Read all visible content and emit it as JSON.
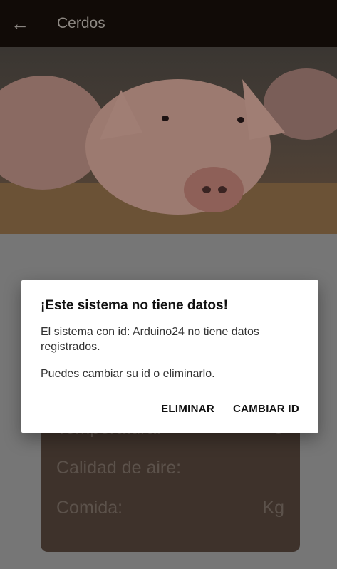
{
  "appbar": {
    "title": "Cerdos",
    "back_icon": "arrow-left-icon"
  },
  "hero": {
    "image": "pig-photo"
  },
  "card": {
    "rows": [
      {
        "label": "Temperatura:",
        "unit": "C"
      },
      {
        "label": "Calidad de aire:",
        "unit": ""
      },
      {
        "label": "Comida:",
        "unit": "Kg"
      }
    ]
  },
  "dialog": {
    "title": "¡Este sistema no tiene datos!",
    "message": "El sistema con id: Arduino24 no tiene datos registrados.",
    "message2": "Puedes cambiar su id o eliminarlo.",
    "delete_label": "ELIMINAR",
    "change_label": "CAMBIAR ID"
  },
  "colors": {
    "appbar": "#110b07",
    "scrim": "#767676",
    "card": "#3e322b",
    "dialog": "#ffffff"
  }
}
